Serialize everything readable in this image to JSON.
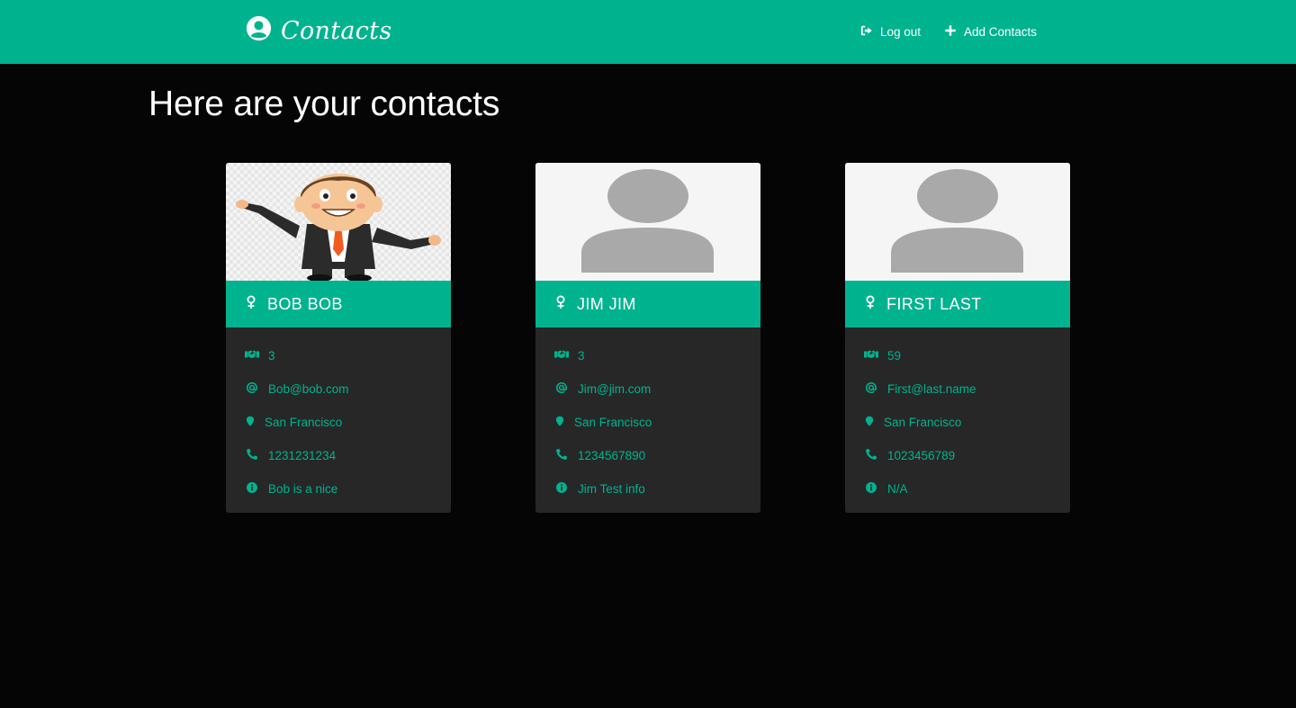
{
  "nav": {
    "brand": "Contacts",
    "logout_label": "Log out",
    "add_label": "Add Contacts"
  },
  "page": {
    "title": "Here are your contacts"
  },
  "contacts": [
    {
      "name": "BOB BOB",
      "count": "3",
      "email": "Bob@bob.com",
      "location": "San Francisco",
      "phone": "1231231234",
      "info": "Bob is a nice",
      "photo": "cartoon-man-avatar"
    },
    {
      "name": "JIM JIM",
      "count": "3",
      "email": "Jim@jim.com",
      "location": "San Francisco",
      "phone": "1234567890",
      "info": "Jim Test info",
      "photo": "default-person-avatar"
    },
    {
      "name": "FIRST LAST",
      "count": "59",
      "email": "First@last.name",
      "location": "San Francisco",
      "phone": "1023456789",
      "info": "N/A",
      "photo": "default-person-avatar"
    }
  ],
  "colors": {
    "accent": "#00b38f",
    "background": "#050505",
    "card": "#272727"
  },
  "icons": [
    "user-circle-icon",
    "sign-out-icon",
    "plus-icon",
    "female-icon",
    "handshake-icon",
    "at-icon",
    "map-marker-icon",
    "phone-icon",
    "info-circle-icon"
  ]
}
